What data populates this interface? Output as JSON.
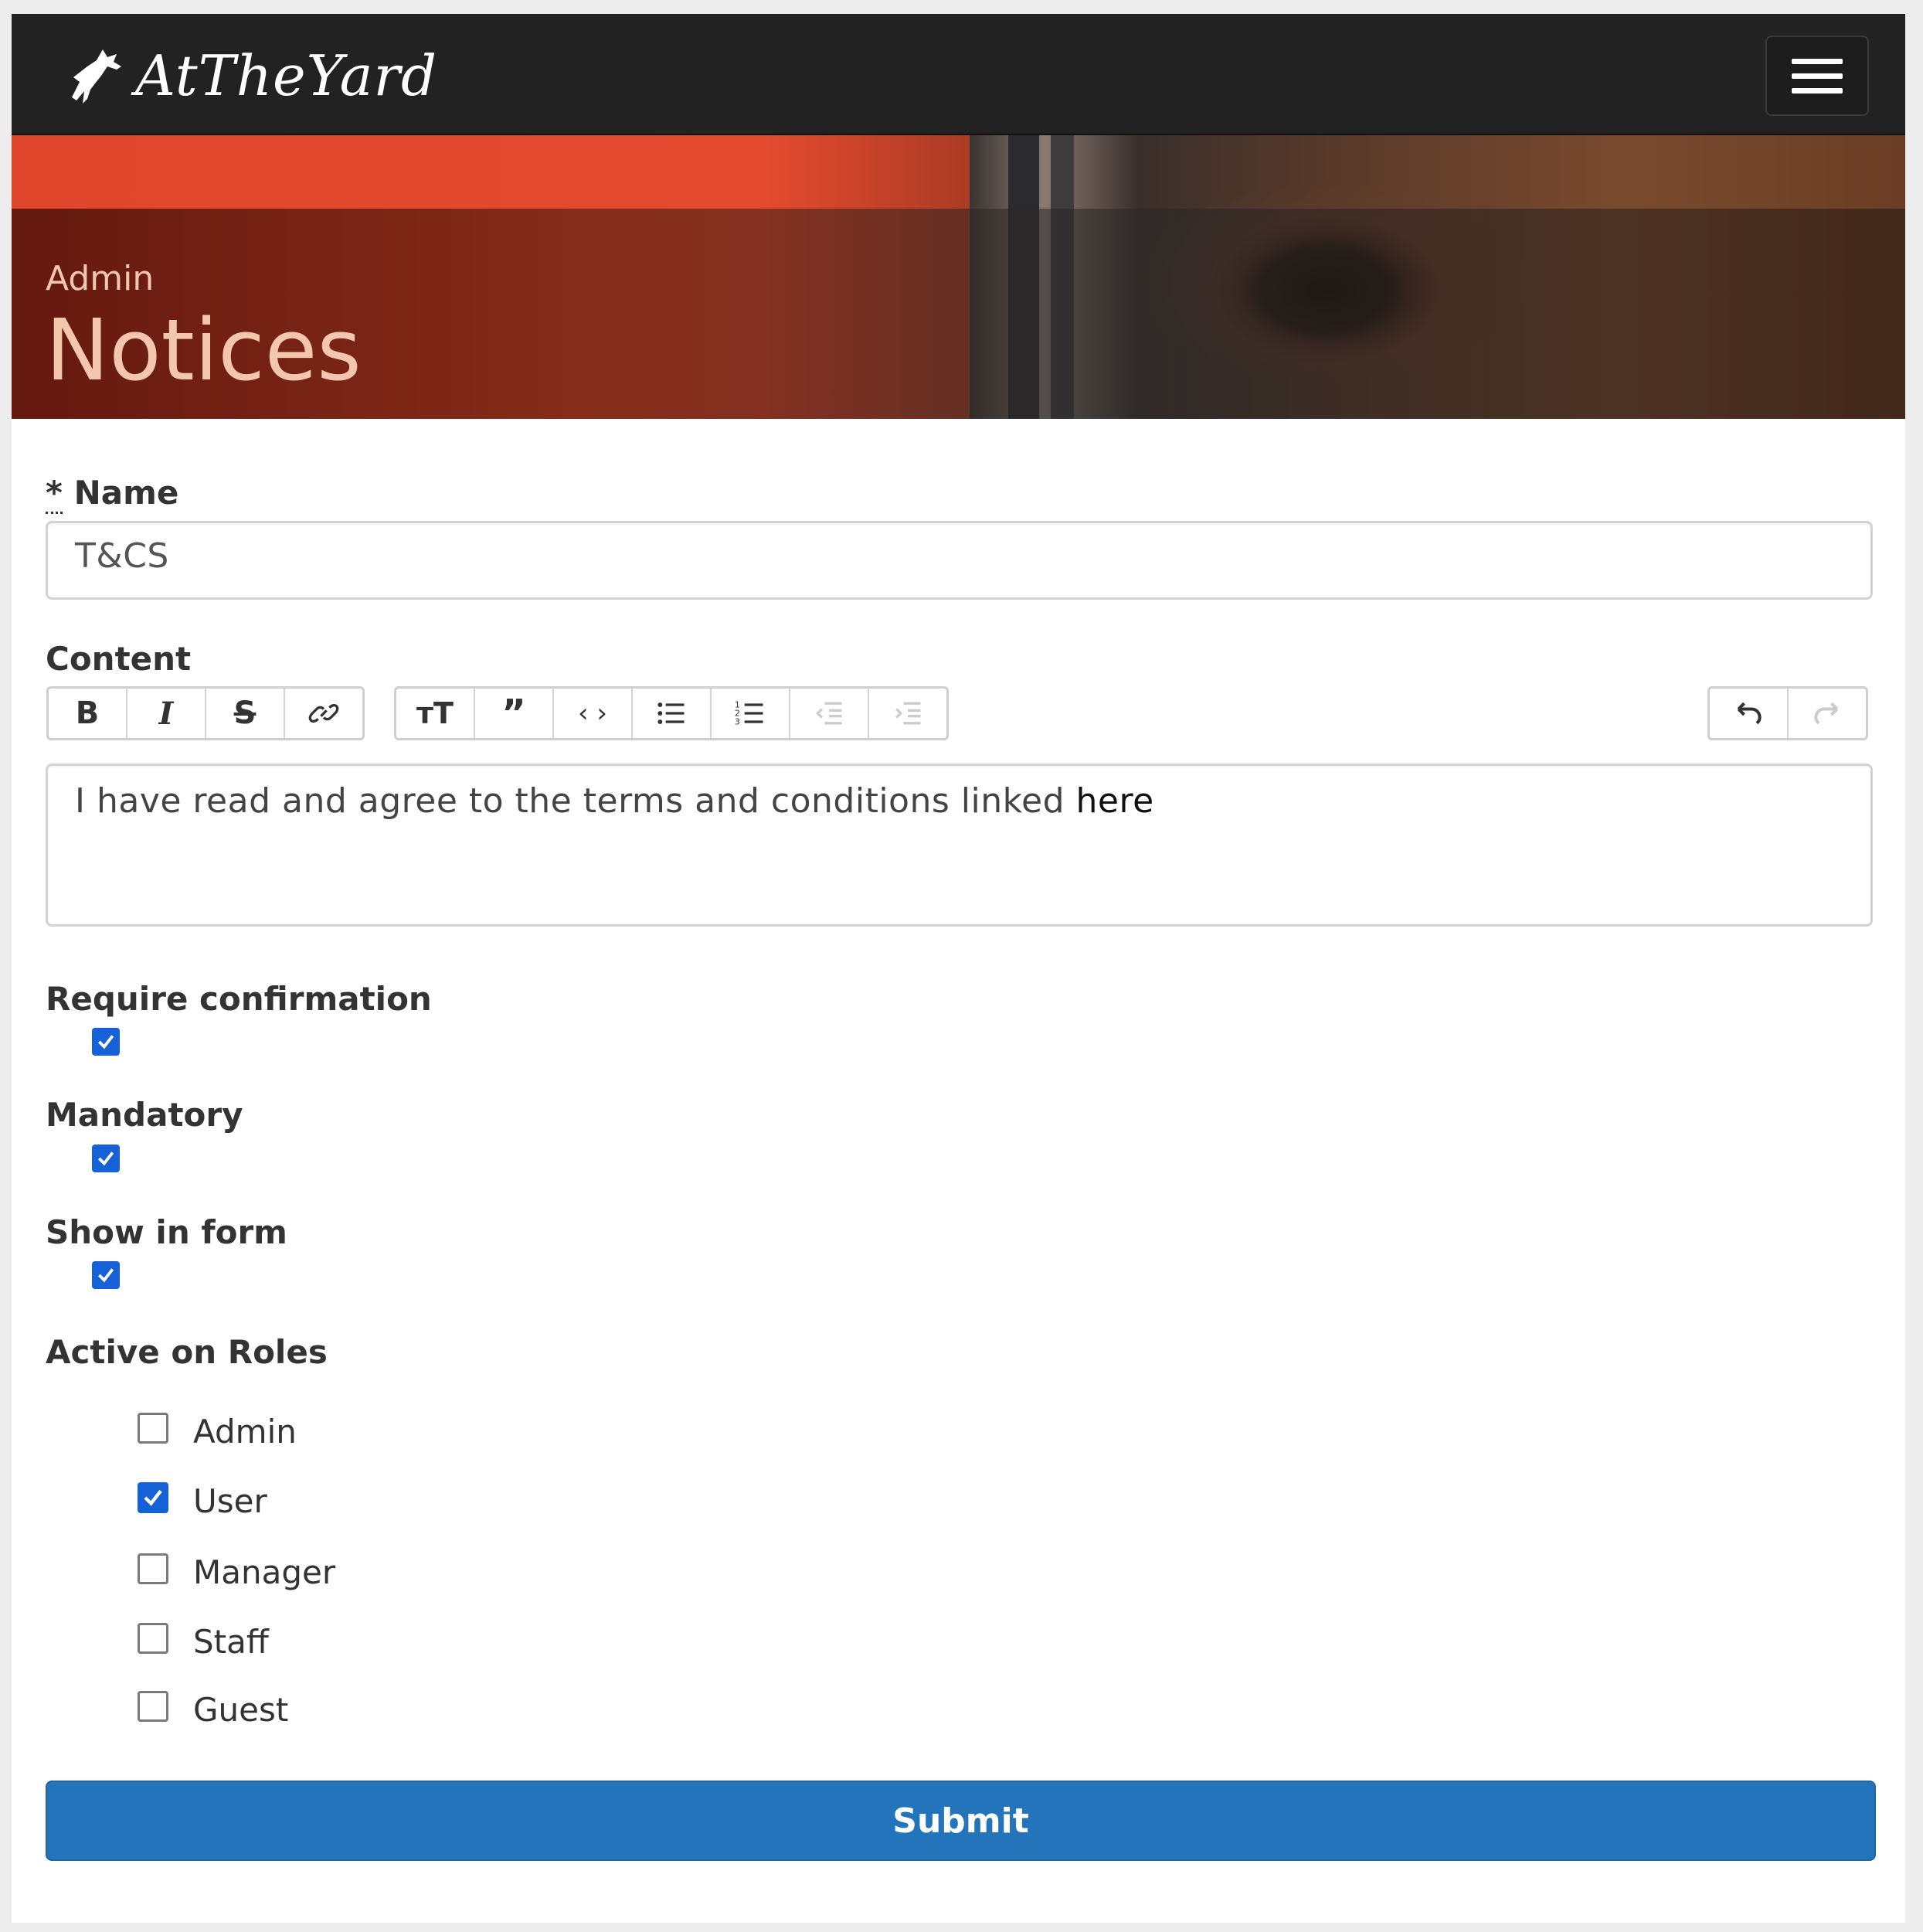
{
  "navbar": {
    "brand": "AtTheYard",
    "menu_icon": "hamburger-menu-icon"
  },
  "banner": {
    "subtitle": "Admin",
    "title": "Notices"
  },
  "form": {
    "name": {
      "required_mark": "*",
      "label": "Name",
      "value": "T&CS"
    },
    "content": {
      "label": "Content",
      "toolbar_left": [
        "bold-icon",
        "italic-icon",
        "strikethrough-icon",
        "link-icon"
      ],
      "toolbar_middle": [
        "heading-icon",
        "quote-icon",
        "code-icon",
        "bullet-list-icon",
        "numbered-list-icon",
        "outdent-icon",
        "indent-icon"
      ],
      "toolbar_right": [
        "undo-icon",
        "redo-icon"
      ],
      "text": "I have read and agree to the terms and conditions linked",
      "link_text": "here"
    },
    "require_confirmation": {
      "label": "Require confirmation",
      "checked": true
    },
    "mandatory": {
      "label": "Mandatory",
      "checked": true
    },
    "show_in_form": {
      "label": "Show in form",
      "checked": true
    },
    "roles": {
      "label": "Active on Roles",
      "items": [
        {
          "label": "Admin",
          "checked": false
        },
        {
          "label": "User",
          "checked": true
        },
        {
          "label": "Manager",
          "checked": false
        },
        {
          "label": "Staff",
          "checked": false
        },
        {
          "label": "Guest",
          "checked": false
        }
      ]
    },
    "submit_label": "Submit"
  },
  "colors": {
    "navbar_bg": "#222222",
    "accent_blue": "#2474bb",
    "checkbox_blue": "#1660d8",
    "banner_text": "#f3c7ad"
  }
}
